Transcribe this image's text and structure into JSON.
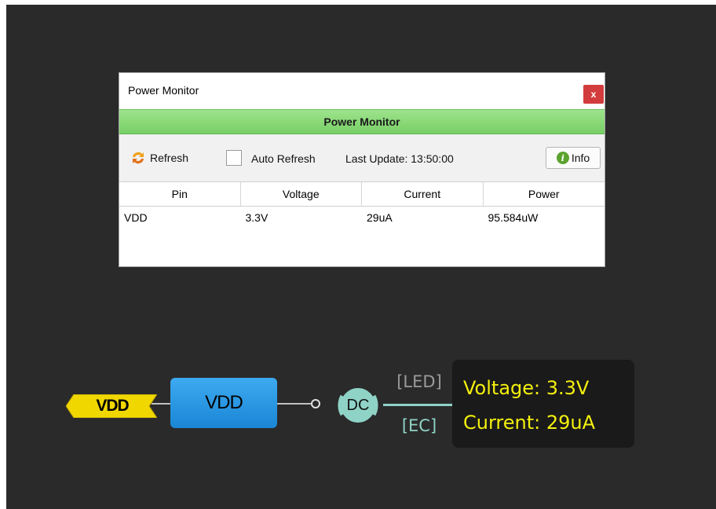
{
  "dialog": {
    "title": "Power Monitor",
    "close_label": "x",
    "banner": "Power Monitor",
    "toolbar": {
      "refresh_label": "Refresh",
      "auto_refresh_label": "Auto Refresh",
      "auto_refresh_checked": false,
      "last_update": "Last Update: 13:50:00",
      "info_label": "Info"
    },
    "table": {
      "columns": [
        "Pin",
        "Voltage",
        "Current",
        "Power"
      ],
      "rows": [
        [
          "VDD",
          "3.3V",
          "29uA",
          "95.584uW"
        ]
      ]
    }
  },
  "schematic": {
    "vdd_tag": "VDD",
    "vdd_block": "VDD",
    "dc_label": "DC",
    "led_label": "[LED]",
    "ec_label": "[EC]",
    "readout": {
      "voltage": "Voltage: 3.3V",
      "current": "Current: 29uA"
    }
  },
  "colors": {
    "canvas_bg": "#2a2a2a",
    "banner_green": "#8fdc7c",
    "vdd_tag": "#f0d700",
    "vdd_block": "#2a9be6",
    "readout_text": "#f4f00e",
    "dc_teal": "#8fd3c6"
  }
}
